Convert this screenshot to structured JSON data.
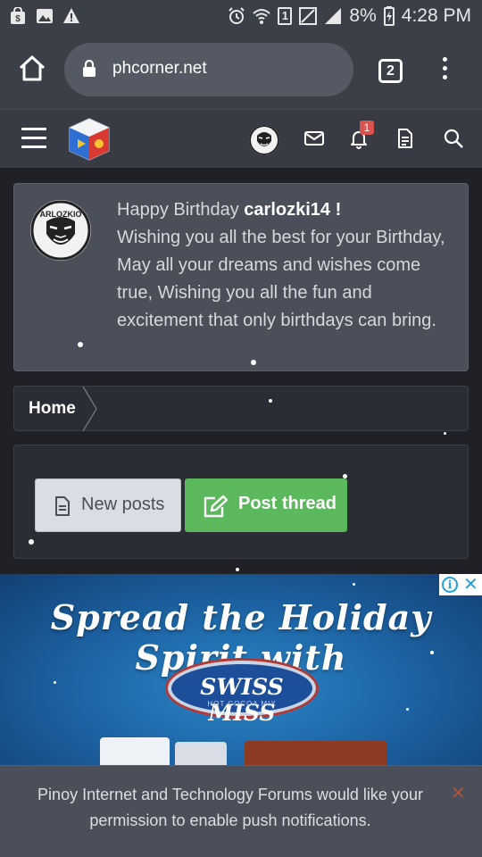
{
  "status_bar": {
    "battery": "8%",
    "time": "4:28 PM",
    "sim_badge": "1",
    "icons": [
      "shopping-bag-icon",
      "image-icon",
      "warning-icon",
      "alarm-icon",
      "wifi-icon",
      "sim-icon",
      "no-signal-icon",
      "signal-icon",
      "battery-icon"
    ]
  },
  "browser": {
    "url": "phcorner.net",
    "tab_count": "2",
    "icons": [
      "home-icon",
      "lock-icon",
      "more-vert-icon"
    ]
  },
  "site_header": {
    "notification_count": "1",
    "icons": [
      "menu-icon",
      "site-logo",
      "user-avatar",
      "envelope-icon",
      "bell-icon",
      "document-icon",
      "search-icon"
    ]
  },
  "birthday": {
    "greeting": "Happy Birthday ",
    "username": "carlozki14",
    "exclaim": " !",
    "message": "Wishing you all the best for your Birthday, May all your dreams and wishes come true, Wishing you all the fun and excitement that only birthdays can bring.",
    "avatar_text": "ARLOZKIO"
  },
  "breadcrumb": {
    "home_label": "Home"
  },
  "actions": {
    "new_posts_label": "New posts",
    "post_thread_label": "Post thread"
  },
  "ad": {
    "headline": "Spread the Holiday Spirit with",
    "brand": "SWISS MISS",
    "brand_sub": "HOT COCOA MIX",
    "adchoices_icon": "info-icon"
  },
  "push_prompt": {
    "message": "Pinoy Internet and Technology Forums would like your permission to enable push notifications.",
    "close_icon": "close-icon"
  },
  "colors": {
    "page_bg": "#1f2126",
    "chrome_bg": "#3b3f47",
    "card_bg": "#4a4f5a",
    "accent_green": "#5cb85c",
    "badge_red": "#d9534f"
  }
}
